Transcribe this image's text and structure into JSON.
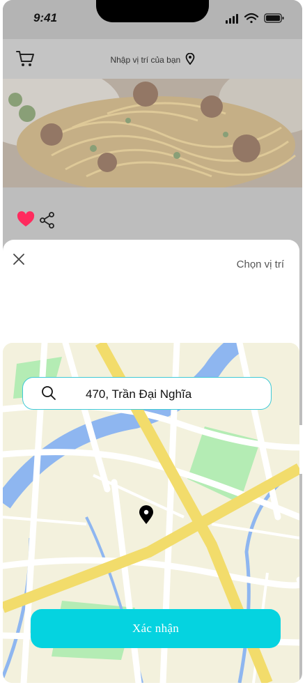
{
  "status_bar": {
    "time": "9:41"
  },
  "header": {
    "location_prompt": "Nhập vị trí của bạn"
  },
  "icons": {
    "cart": "shopping-cart-icon",
    "location": "map-pin-icon",
    "favorite": "heart-icon",
    "share": "share-icon",
    "close": "close-icon",
    "search": "search-icon"
  },
  "sheet": {
    "title": "Chọn vị trí",
    "search_value": "470, Trần Đại Nghĩa",
    "confirm_label": "Xác nhận"
  },
  "colors": {
    "accent": "#05d3e0",
    "search_border": "#3ec9d6",
    "heart": "#ff2b5e",
    "map_road_major": "#f2dc6b",
    "map_water": "#8eb6f0",
    "map_park": "#b4ecb4"
  }
}
